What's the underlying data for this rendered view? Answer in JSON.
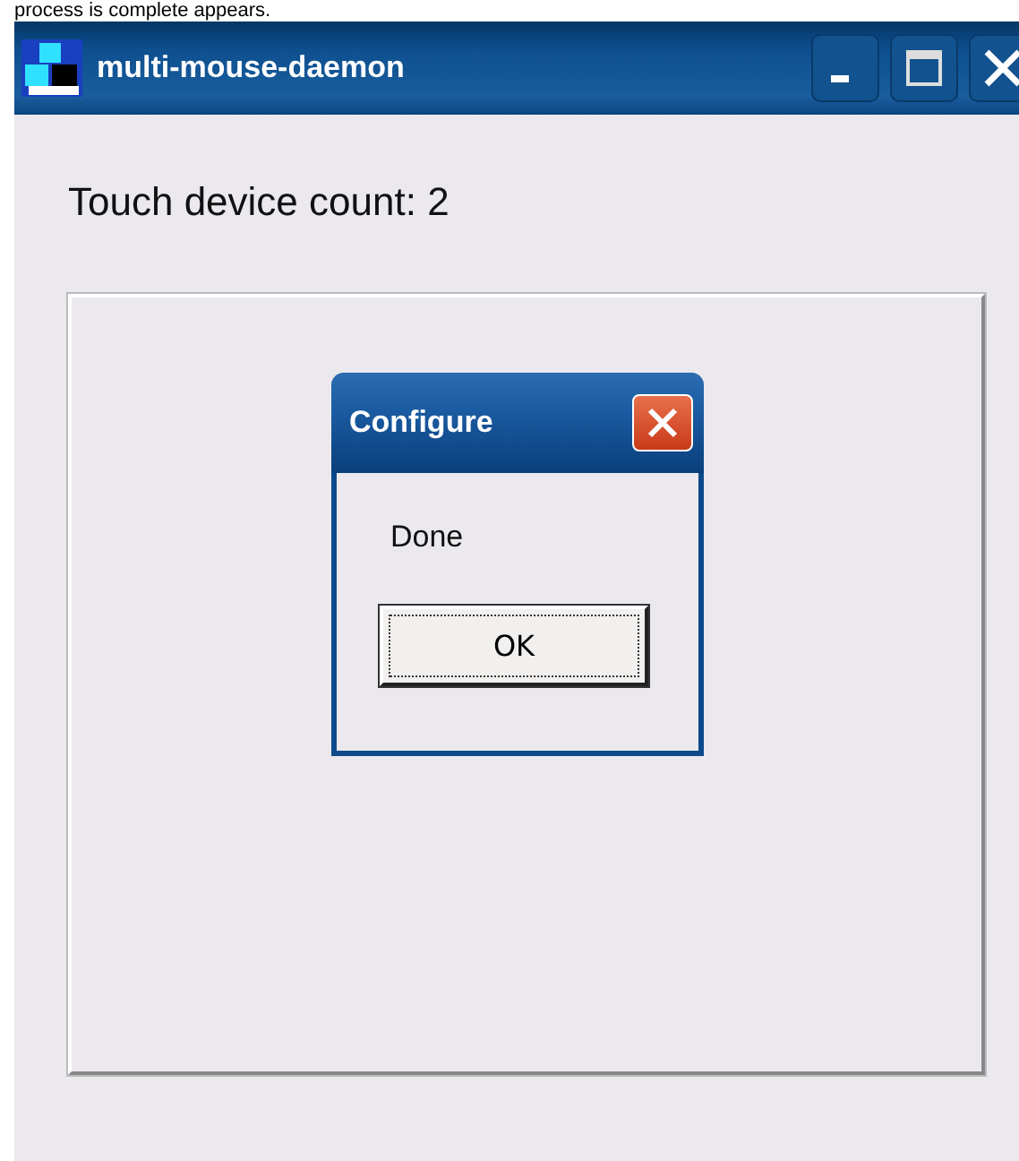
{
  "caption": "process is complete appears.",
  "window": {
    "title": "multi-mouse-daemon"
  },
  "count_label": "Touch device count: 2",
  "dialog": {
    "title": "Configure",
    "message": "Done",
    "buttons": [
      "OK"
    ]
  }
}
